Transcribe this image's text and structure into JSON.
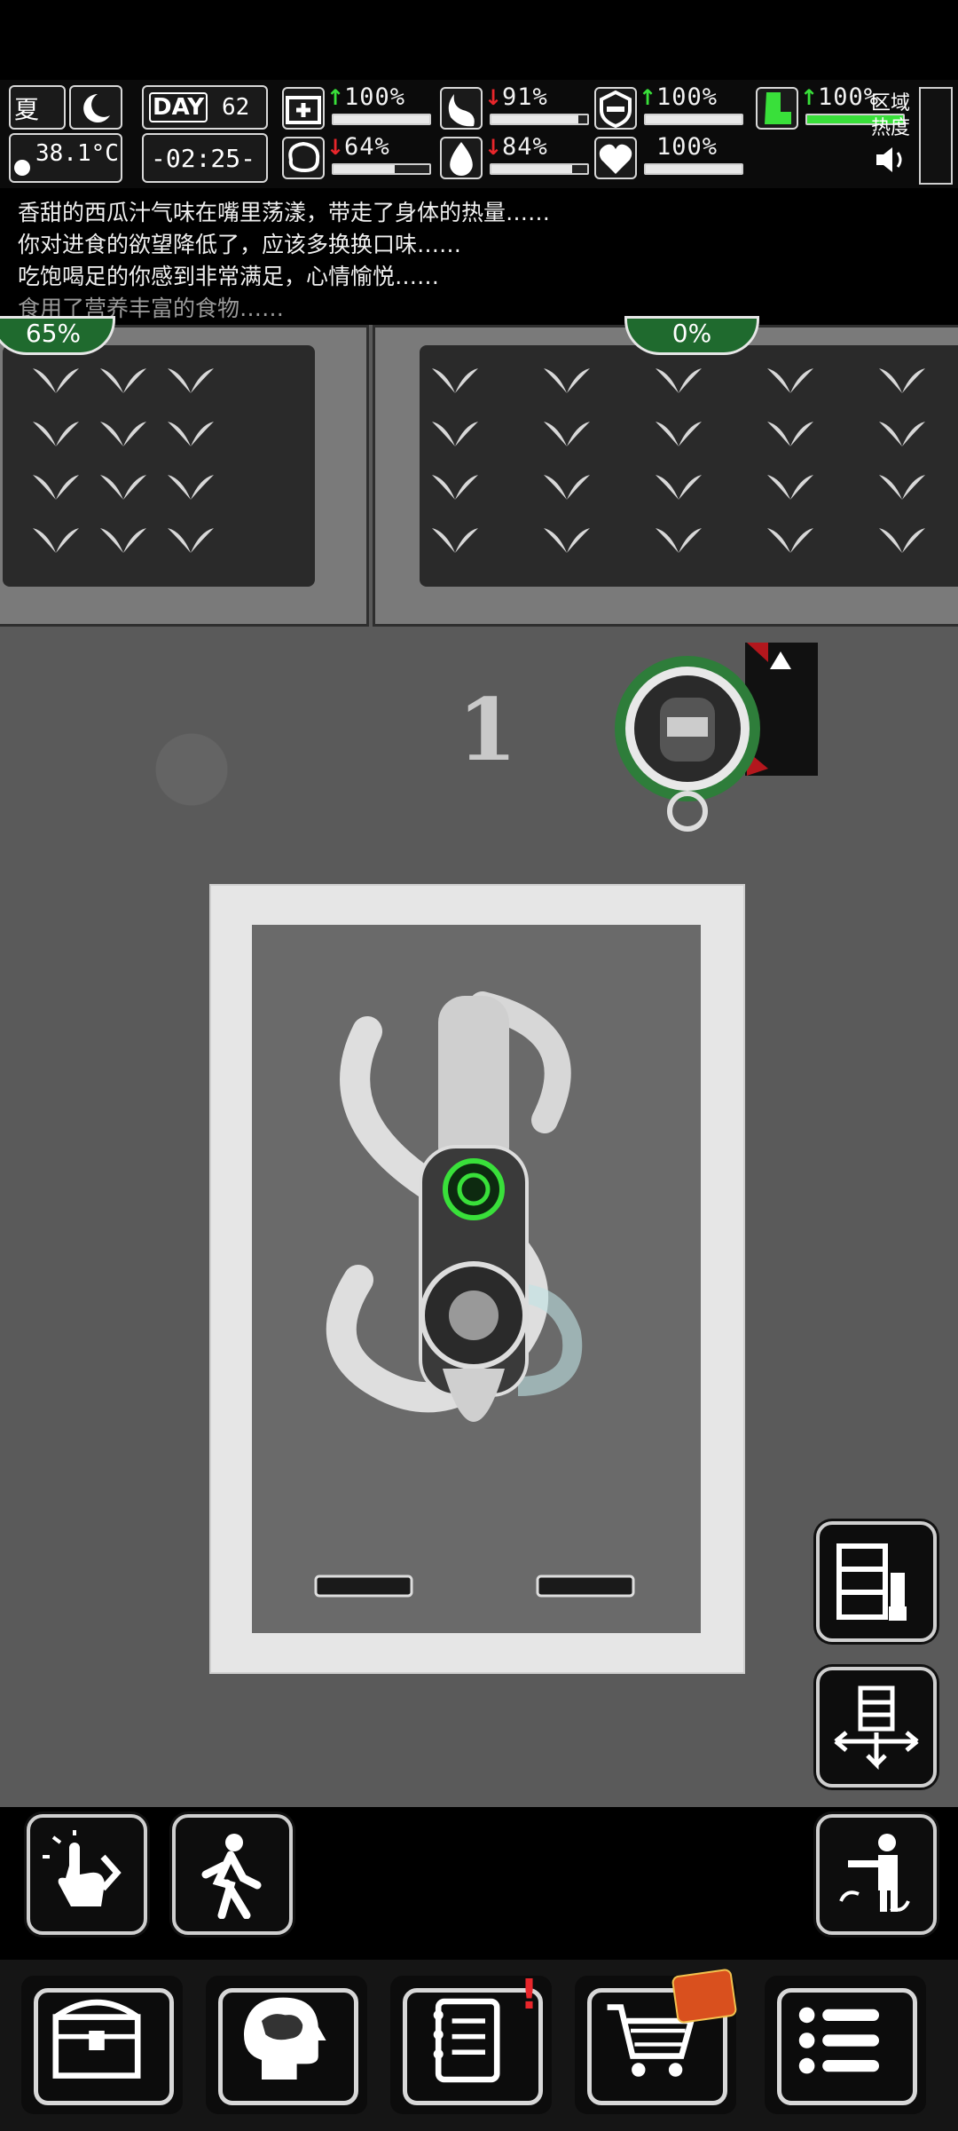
{
  "hud": {
    "season": "夏",
    "temperature": "38.1°C",
    "day_label": "DAY",
    "day_number": "62",
    "clock": "-02:25-",
    "region_heat_label_1": "区域",
    "region_heat_label_2": "热度",
    "stats": [
      {
        "icon": "medkit-icon",
        "trend": "up",
        "value": "100%",
        "level": 1.0
      },
      {
        "icon": "stomach-icon",
        "trend": "down",
        "value": "91%",
        "level": 0.91
      },
      {
        "icon": "shield-icon",
        "trend": "up",
        "value": "100%",
        "level": 1.0
      },
      {
        "icon": "boot-icon",
        "trend": "up",
        "value": "100%",
        "level": 1.0
      },
      {
        "icon": "brain-icon",
        "trend": "down",
        "value": "64%",
        "level": 0.64
      },
      {
        "icon": "water-drop-icon",
        "trend": "down",
        "value": "84%",
        "level": 0.84
      },
      {
        "icon": "heart-icon",
        "trend": "none",
        "value": "100%",
        "level": 1.0
      }
    ]
  },
  "log": [
    "香甜的西瓜汁气味在嘴里荡漾，带走了身体的热量……",
    "你对进食的欲望降低了，应该多换换口味……",
    "吃饱喝足的你感到非常满足，心情愉悦……",
    "食用了营养丰富的食物……"
  ],
  "map": {
    "plot_left_percent": "65%",
    "plot_right_percent": "0%",
    "floor_marker": "1"
  },
  "colors": {
    "accent_green": "#39e03a",
    "alert_red": "#e8262b",
    "badge_green": "#1f6a2e"
  }
}
